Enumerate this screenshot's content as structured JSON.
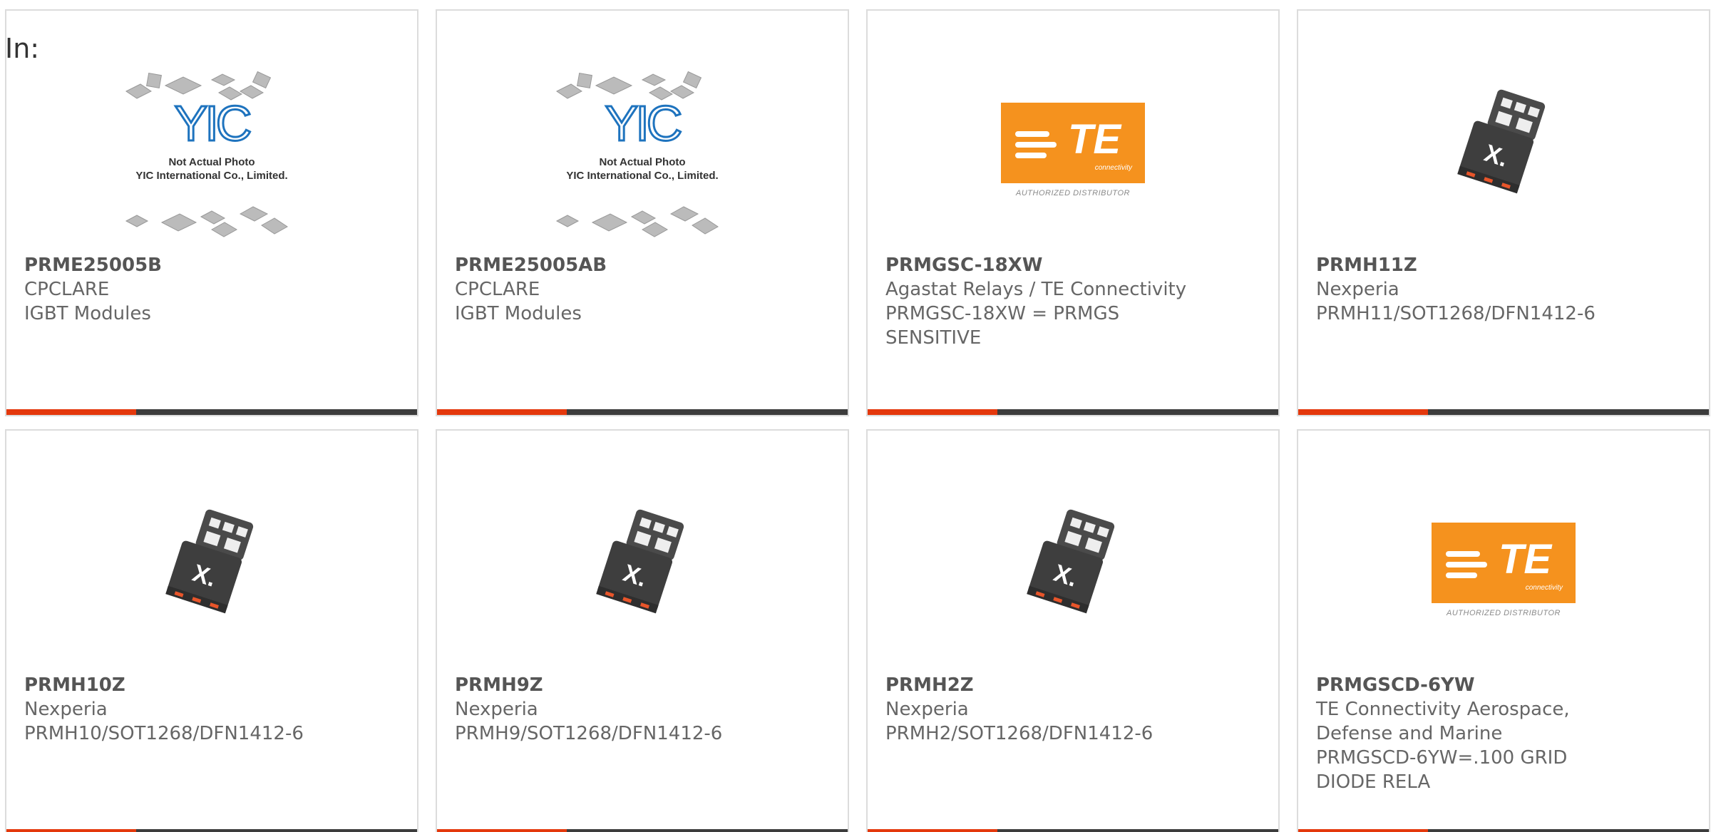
{
  "filter_label": "In:",
  "yic_caption_line1": "Not Actual Photo",
  "yic_caption_line2": "YIC International Co., Limited.",
  "yic_brand": "YIC",
  "te_logo_text": "TE",
  "te_logo_sub": "connectivity",
  "te_authorized": "AUTHORIZED DISTRIBUTOR",
  "colors": {
    "accent": "#e4380c",
    "bar": "#3c3c3c",
    "te_orange": "#f5921e"
  },
  "products": [
    {
      "part": "PRME25005B",
      "lines": [
        "CPCLARE",
        "IGBT Modules"
      ],
      "image": "yic-placeholder"
    },
    {
      "part": "PRME25005AB",
      "lines": [
        "CPCLARE",
        "IGBT Modules"
      ],
      "image": "yic-placeholder"
    },
    {
      "part": "PRMGSC-18XW",
      "lines": [
        "Agastat Relays / TE Connectivity",
        "PRMGSC-18XW = PRMGS",
        "SENSITIVE"
      ],
      "image": "te-logo"
    },
    {
      "part": "PRMH11Z",
      "lines": [
        "Nexperia",
        "PRMH11/SOT1268/DFN1412-6"
      ],
      "image": "nexperia-chip"
    },
    {
      "part": "PRMH10Z",
      "lines": [
        "Nexperia",
        "PRMH10/SOT1268/DFN1412-6"
      ],
      "image": "nexperia-chip"
    },
    {
      "part": "PRMH9Z",
      "lines": [
        "Nexperia",
        "PRMH9/SOT1268/DFN1412-6"
      ],
      "image": "nexperia-chip"
    },
    {
      "part": "PRMH2Z",
      "lines": [
        "Nexperia",
        "PRMH2/SOT1268/DFN1412-6"
      ],
      "image": "nexperia-chip"
    },
    {
      "part": "PRMGSCD-6YW",
      "lines": [
        "TE Connectivity Aerospace,",
        "Defense and Marine",
        "PRMGSCD-6YW=.100 GRID",
        "DIODE RELA"
      ],
      "image": "te-logo"
    }
  ]
}
